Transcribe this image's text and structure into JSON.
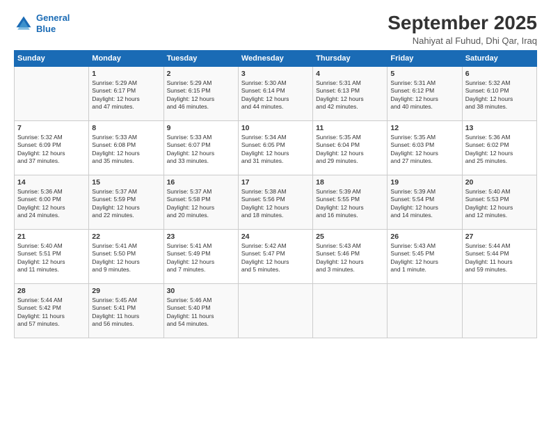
{
  "header": {
    "logo_line1": "General",
    "logo_line2": "Blue",
    "title": "September 2025",
    "subtitle": "Nahiyat al Fuhud, Dhi Qar, Iraq"
  },
  "days_of_week": [
    "Sunday",
    "Monday",
    "Tuesday",
    "Wednesday",
    "Thursday",
    "Friday",
    "Saturday"
  ],
  "weeks": [
    [
      {
        "day": "",
        "info": ""
      },
      {
        "day": "1",
        "info": "Sunrise: 5:29 AM\nSunset: 6:17 PM\nDaylight: 12 hours\nand 47 minutes."
      },
      {
        "day": "2",
        "info": "Sunrise: 5:29 AM\nSunset: 6:15 PM\nDaylight: 12 hours\nand 46 minutes."
      },
      {
        "day": "3",
        "info": "Sunrise: 5:30 AM\nSunset: 6:14 PM\nDaylight: 12 hours\nand 44 minutes."
      },
      {
        "day": "4",
        "info": "Sunrise: 5:31 AM\nSunset: 6:13 PM\nDaylight: 12 hours\nand 42 minutes."
      },
      {
        "day": "5",
        "info": "Sunrise: 5:31 AM\nSunset: 6:12 PM\nDaylight: 12 hours\nand 40 minutes."
      },
      {
        "day": "6",
        "info": "Sunrise: 5:32 AM\nSunset: 6:10 PM\nDaylight: 12 hours\nand 38 minutes."
      }
    ],
    [
      {
        "day": "7",
        "info": "Sunrise: 5:32 AM\nSunset: 6:09 PM\nDaylight: 12 hours\nand 37 minutes."
      },
      {
        "day": "8",
        "info": "Sunrise: 5:33 AM\nSunset: 6:08 PM\nDaylight: 12 hours\nand 35 minutes."
      },
      {
        "day": "9",
        "info": "Sunrise: 5:33 AM\nSunset: 6:07 PM\nDaylight: 12 hours\nand 33 minutes."
      },
      {
        "day": "10",
        "info": "Sunrise: 5:34 AM\nSunset: 6:05 PM\nDaylight: 12 hours\nand 31 minutes."
      },
      {
        "day": "11",
        "info": "Sunrise: 5:35 AM\nSunset: 6:04 PM\nDaylight: 12 hours\nand 29 minutes."
      },
      {
        "day": "12",
        "info": "Sunrise: 5:35 AM\nSunset: 6:03 PM\nDaylight: 12 hours\nand 27 minutes."
      },
      {
        "day": "13",
        "info": "Sunrise: 5:36 AM\nSunset: 6:02 PM\nDaylight: 12 hours\nand 25 minutes."
      }
    ],
    [
      {
        "day": "14",
        "info": "Sunrise: 5:36 AM\nSunset: 6:00 PM\nDaylight: 12 hours\nand 24 minutes."
      },
      {
        "day": "15",
        "info": "Sunrise: 5:37 AM\nSunset: 5:59 PM\nDaylight: 12 hours\nand 22 minutes."
      },
      {
        "day": "16",
        "info": "Sunrise: 5:37 AM\nSunset: 5:58 PM\nDaylight: 12 hours\nand 20 minutes."
      },
      {
        "day": "17",
        "info": "Sunrise: 5:38 AM\nSunset: 5:56 PM\nDaylight: 12 hours\nand 18 minutes."
      },
      {
        "day": "18",
        "info": "Sunrise: 5:39 AM\nSunset: 5:55 PM\nDaylight: 12 hours\nand 16 minutes."
      },
      {
        "day": "19",
        "info": "Sunrise: 5:39 AM\nSunset: 5:54 PM\nDaylight: 12 hours\nand 14 minutes."
      },
      {
        "day": "20",
        "info": "Sunrise: 5:40 AM\nSunset: 5:53 PM\nDaylight: 12 hours\nand 12 minutes."
      }
    ],
    [
      {
        "day": "21",
        "info": "Sunrise: 5:40 AM\nSunset: 5:51 PM\nDaylight: 12 hours\nand 11 minutes."
      },
      {
        "day": "22",
        "info": "Sunrise: 5:41 AM\nSunset: 5:50 PM\nDaylight: 12 hours\nand 9 minutes."
      },
      {
        "day": "23",
        "info": "Sunrise: 5:41 AM\nSunset: 5:49 PM\nDaylight: 12 hours\nand 7 minutes."
      },
      {
        "day": "24",
        "info": "Sunrise: 5:42 AM\nSunset: 5:47 PM\nDaylight: 12 hours\nand 5 minutes."
      },
      {
        "day": "25",
        "info": "Sunrise: 5:43 AM\nSunset: 5:46 PM\nDaylight: 12 hours\nand 3 minutes."
      },
      {
        "day": "26",
        "info": "Sunrise: 5:43 AM\nSunset: 5:45 PM\nDaylight: 12 hours\nand 1 minute."
      },
      {
        "day": "27",
        "info": "Sunrise: 5:44 AM\nSunset: 5:44 PM\nDaylight: 11 hours\nand 59 minutes."
      }
    ],
    [
      {
        "day": "28",
        "info": "Sunrise: 5:44 AM\nSunset: 5:42 PM\nDaylight: 11 hours\nand 57 minutes."
      },
      {
        "day": "29",
        "info": "Sunrise: 5:45 AM\nSunset: 5:41 PM\nDaylight: 11 hours\nand 56 minutes."
      },
      {
        "day": "30",
        "info": "Sunrise: 5:46 AM\nSunset: 5:40 PM\nDaylight: 11 hours\nand 54 minutes."
      },
      {
        "day": "",
        "info": ""
      },
      {
        "day": "",
        "info": ""
      },
      {
        "day": "",
        "info": ""
      },
      {
        "day": "",
        "info": ""
      }
    ]
  ]
}
